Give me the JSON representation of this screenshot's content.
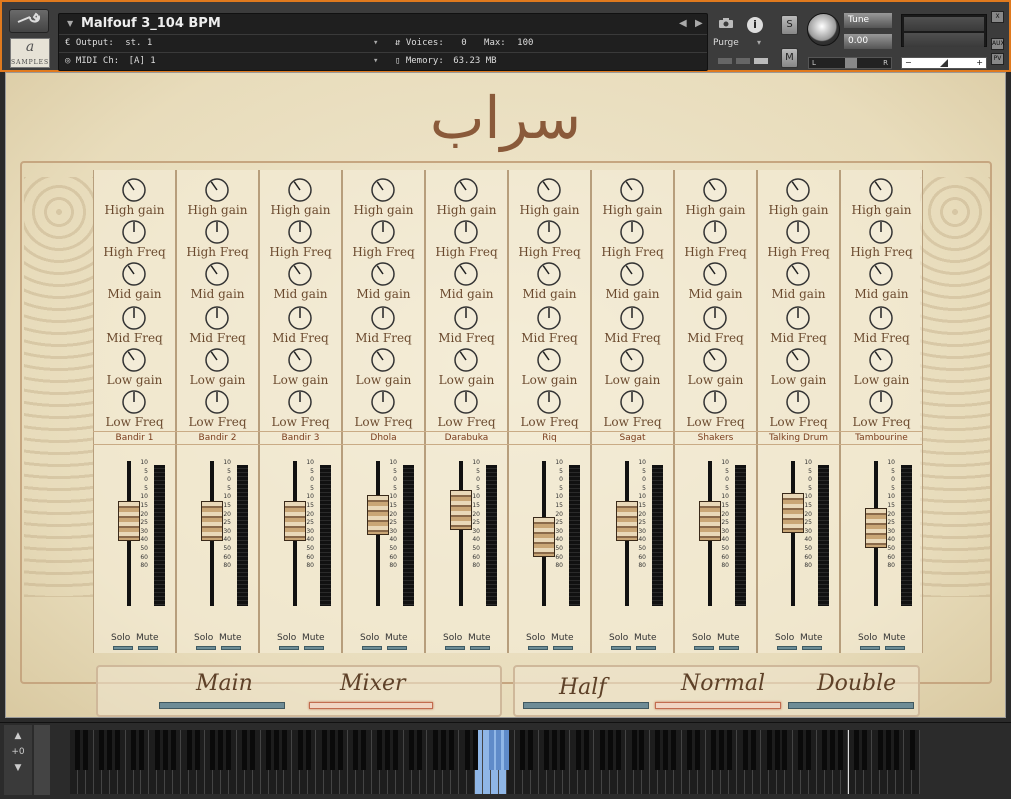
{
  "header": {
    "instrument_name": "Malfouf 3_104 BPM",
    "output_label": "Output:",
    "output_value": "st. 1",
    "midi_label": "MIDI Ch:",
    "midi_value": "[A]  1",
    "voices_label": "Voices:",
    "voices_value": "0",
    "max_label": "Max:",
    "max_value": "100",
    "memory_label": "Memory:",
    "memory_value": "63.23 MB",
    "purge_label": "Purge",
    "solo_btn": "S",
    "mute_btn": "M",
    "tune_label": "Tune",
    "tune_value": "0.00",
    "pan_left": "L",
    "pan_right": "R",
    "vol_minus": "−",
    "vol_plus": "+",
    "aux_label": "AUX",
    "pv_label": "PV",
    "close_label": "X",
    "logo_text": "SAMPLES"
  },
  "title": "سراب",
  "knob_labels": [
    "High gain",
    "High Freq",
    "Mid gain",
    "Mid Freq",
    "Low gain",
    "Low Freq"
  ],
  "channels": [
    {
      "name": "Bandir 1",
      "fader": 0.62
    },
    {
      "name": "Bandir 2",
      "fader": 0.62
    },
    {
      "name": "Bandir 3",
      "fader": 0.62
    },
    {
      "name": "Dhola",
      "fader": 0.68
    },
    {
      "name": "Darabuka",
      "fader": 0.72
    },
    {
      "name": "Riq",
      "fader": 0.47
    },
    {
      "name": "Sagat",
      "fader": 0.62
    },
    {
      "name": "Shakers",
      "fader": 0.62
    },
    {
      "name": "Talking Drum",
      "fader": 0.7
    },
    {
      "name": "Tambourine",
      "fader": 0.55
    }
  ],
  "solo_label": "Solo",
  "mute_label": "Mute",
  "fader_scale": [
    "10",
    "5",
    "0",
    "5",
    "10",
    "15",
    "20",
    "25",
    "30",
    "40",
    "50",
    "60",
    "80"
  ],
  "modes": {
    "main": "Main",
    "mixer": "Mixer",
    "half": "Half",
    "normal": "Normal",
    "double": "Double",
    "active_view": "Mixer",
    "active_speed": "Normal"
  },
  "keyboard": {
    "octave": "+0"
  },
  "colors": {
    "accent": "#e07a1e",
    "led": "#6d8d96",
    "active": "#c26c4f"
  }
}
